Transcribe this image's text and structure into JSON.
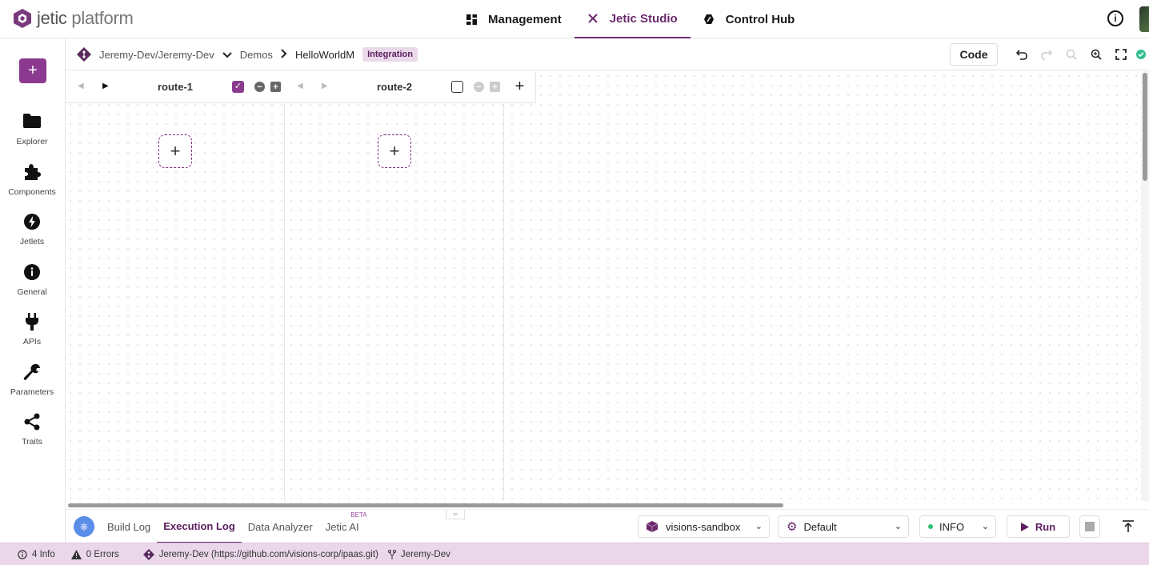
{
  "app": {
    "logo_word": "jetic",
    "logo_rest": " platform"
  },
  "nav": [
    {
      "label": "Management",
      "icon": "grid-icon"
    },
    {
      "label": "Jetic Studio",
      "icon": "tools-icon",
      "active": true
    },
    {
      "label": "Control Hub",
      "icon": "hub-icon"
    }
  ],
  "sidebar": {
    "add_label": "+",
    "items": [
      {
        "label": "Explorer",
        "icon": "folder-icon"
      },
      {
        "label": "Components",
        "icon": "puzzle-icon"
      },
      {
        "label": "Jetlets",
        "icon": "bolt-icon"
      },
      {
        "label": "General",
        "icon": "info-icon"
      },
      {
        "label": "APIs",
        "icon": "plug-icon"
      },
      {
        "label": "Parameters",
        "icon": "wrench-icon"
      },
      {
        "label": "Traits",
        "icon": "share-icon"
      }
    ]
  },
  "breadcrumb": {
    "repo": "Jeremy-Dev/Jeremy-Dev",
    "folder": "Demos",
    "file": "HelloWorldM",
    "badge": "Integration"
  },
  "toolbar": {
    "code_label": "Code"
  },
  "routes": [
    {
      "name": "route-1",
      "checked": true
    },
    {
      "name": "route-2",
      "checked": false
    }
  ],
  "add_route_label": "+",
  "bottom": {
    "tabs": [
      {
        "label": "Build Log",
        "active": false
      },
      {
        "label": "Execution Log",
        "active": true
      },
      {
        "label": "Data Analyzer",
        "active": false
      },
      {
        "label": "Jetic AI",
        "active": false,
        "badge": "BETA"
      }
    ],
    "environment": "visions-sandbox",
    "profile": "Default",
    "log_level": "INFO",
    "run_label": "Run"
  },
  "status": {
    "info": "4 Info",
    "errors": "0 Errors",
    "repo": "Jeremy-Dev (https://github.com/visions-corp/ipaas.git)",
    "branch": "Jeremy-Dev"
  },
  "colors": {
    "accent": "#6b2a6e",
    "accent_light": "#ead8ea",
    "button": "#8b3a8f"
  }
}
